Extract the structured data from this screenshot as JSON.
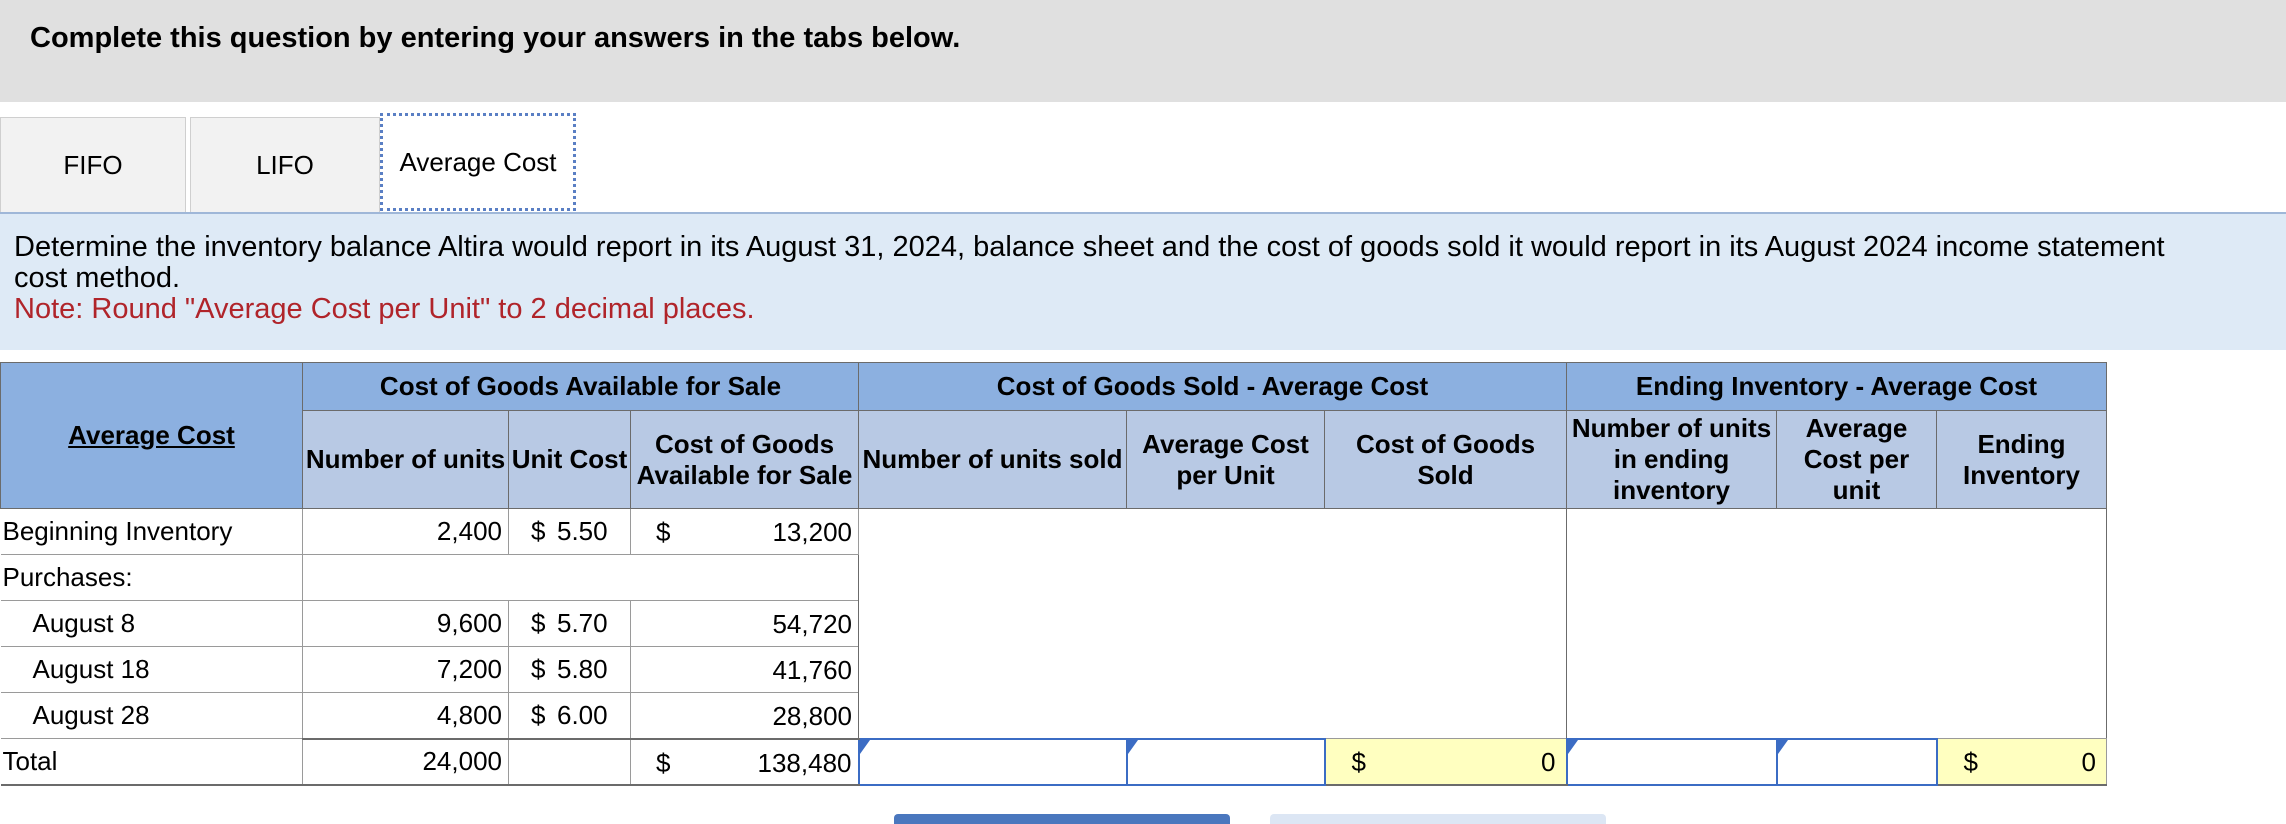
{
  "header": {
    "text": "Complete this question by entering your answers in the tabs below."
  },
  "tabs": [
    {
      "label": "FIFO",
      "active": false
    },
    {
      "label": "LIFO",
      "active": false
    },
    {
      "label": "Average Cost",
      "active": true
    }
  ],
  "instructions": {
    "line1": "Determine the inventory balance Altira would report in its August 31, 2024, balance sheet and the cost of goods sold it would report in its August 2024 income statement",
    "line2": "cost method.",
    "note": "Note: Round \"Average Cost per Unit\" to 2 decimal places."
  },
  "table": {
    "corner_label": "Average Cost",
    "group_headers": {
      "available": "Cost of Goods Available for Sale",
      "sold": "Cost of Goods Sold - Average Cost",
      "ending": "Ending Inventory - Average Cost"
    },
    "sub_headers": {
      "num_units": "Number of units",
      "unit_cost": "Unit Cost",
      "cost_available": "Cost of Goods Available for Sale",
      "units_sold": "Number of units sold",
      "avg_cost_unit": "Average Cost per Unit",
      "cogs": "Cost of Goods Sold",
      "units_ending": "Number of units in ending inventory",
      "avg_cost_per_unit": "Average Cost per unit",
      "ending_inventory": "Ending Inventory"
    },
    "rows": [
      {
        "label": "Beginning Inventory",
        "units": "2,400",
        "unit_cost_symbol": "$",
        "unit_cost": "5.50",
        "cost_symbol": "$",
        "cost": "13,200"
      },
      {
        "label": "Purchases:",
        "units": "",
        "unit_cost_symbol": "",
        "unit_cost": "",
        "cost_symbol": "",
        "cost": ""
      },
      {
        "label": "August 8",
        "units": "9,600",
        "unit_cost_symbol": "$",
        "unit_cost": "5.70",
        "cost_symbol": "",
        "cost": "54,720"
      },
      {
        "label": "August 18",
        "units": "7,200",
        "unit_cost_symbol": "$",
        "unit_cost": "5.80",
        "cost_symbol": "",
        "cost": "41,760"
      },
      {
        "label": "August 28",
        "units": "4,800",
        "unit_cost_symbol": "$",
        "unit_cost": "6.00",
        "cost_symbol": "",
        "cost": "28,800"
      }
    ],
    "total": {
      "label": "Total",
      "units": "24,000",
      "cost_symbol": "$",
      "cost": "138,480",
      "units_sold_value": "",
      "avg_cost_unit_value": "",
      "cogs_symbol": "$",
      "cogs": "0",
      "units_ending_value": "",
      "avg_cost_per_unit_value": "",
      "ending_symbol": "$",
      "ending_inventory": "0"
    }
  },
  "colors": {
    "header_bg": "#e0e0e0",
    "instructions_bg": "#deeaf6",
    "note_text": "#b0242a",
    "table_header": "#8cb0e0",
    "table_subheader": "#b8c9e4",
    "input_border": "#3b6cc4",
    "computed_cell": "#ffffc0"
  }
}
